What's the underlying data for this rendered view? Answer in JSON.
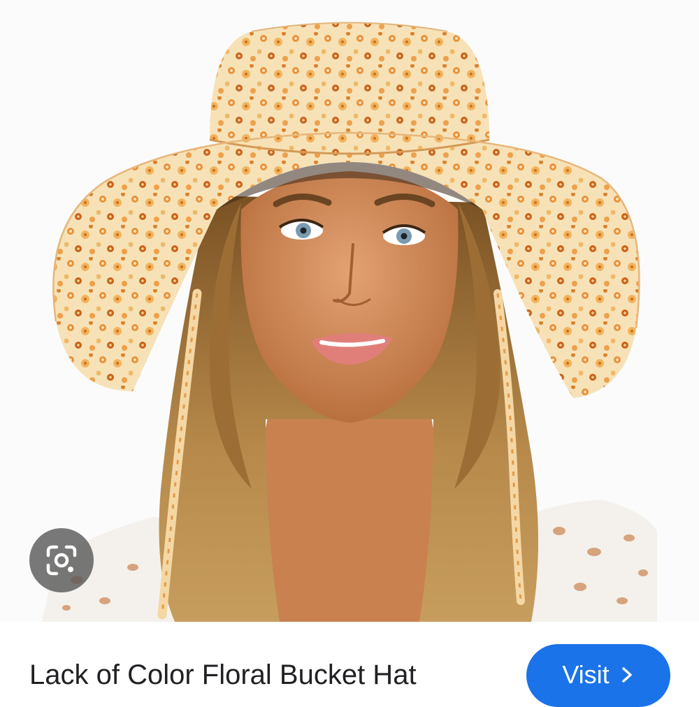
{
  "image": {
    "alt": "Model wearing an orange floral wide-brim bucket hat"
  },
  "lens": {
    "icon": "google-lens-icon"
  },
  "result": {
    "title": "Lack of Color Floral Bucket Hat",
    "visit_label": "Visit",
    "visit_icon": "chevron-right-icon"
  },
  "colors": {
    "accent": "#1a73e8",
    "title_text": "#202124",
    "hat_base": "#f5dcae",
    "hat_flower_dark": "#d9822b",
    "hat_flower_light": "#f0a94a",
    "hair": "#a57a3f",
    "skin": "#d28c5c"
  }
}
